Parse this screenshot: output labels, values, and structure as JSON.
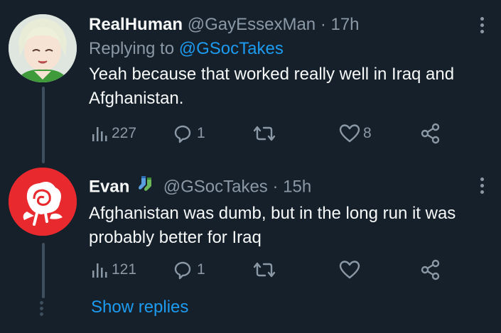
{
  "tweets": [
    {
      "name": "RealHuman",
      "handle": "@GayEssexMan",
      "separator": "·",
      "time": "17h",
      "replying_prefix": "Replying to ",
      "replying_to": "@GSocTakes",
      "text": "Yeah because that worked really well in Iraq and Afghanistan.",
      "views": "227",
      "replies": "1",
      "retweets": "",
      "likes": "8"
    },
    {
      "name": "Evan",
      "name_emoji_icon": "socks-icon",
      "handle": "@GSocTakes",
      "separator": "·",
      "time": "15h",
      "text": "Afghanistan was dumb, but in the long run it was probably better for Iraq",
      "views": "121",
      "replies": "1",
      "retweets": "",
      "likes": ""
    }
  ],
  "show_replies": "Show replies",
  "colors": {
    "background": "#15202b",
    "text": "#f7f9f9",
    "muted": "#8b98a5",
    "link": "#1d9bf0",
    "avatar2": "#e8292e"
  }
}
